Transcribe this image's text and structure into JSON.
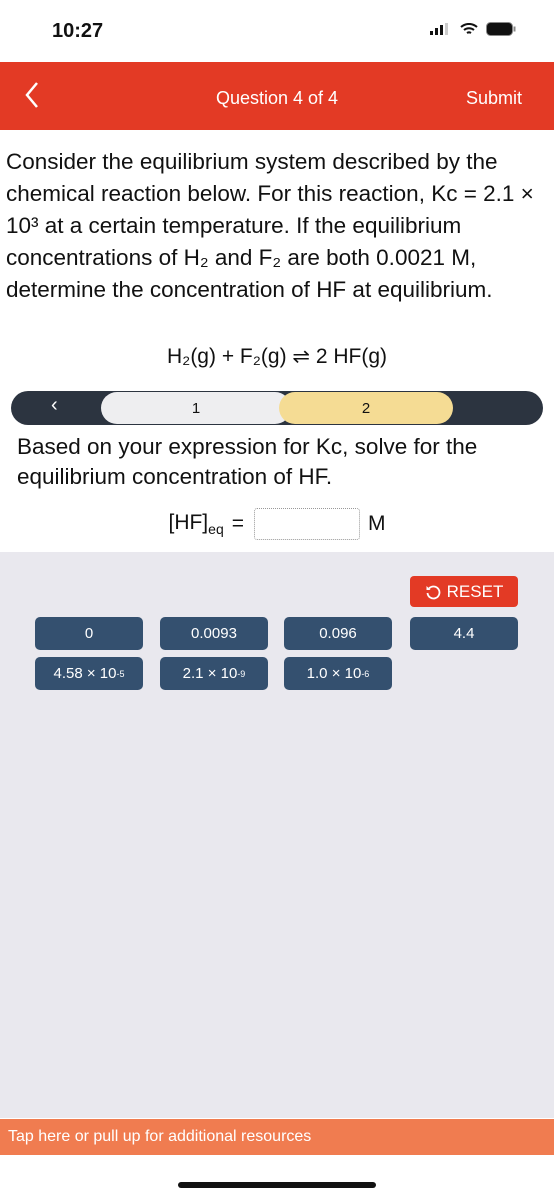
{
  "status": {
    "time": "10:27"
  },
  "header": {
    "back_icon": "chevron-left",
    "title": "Question 4 of 4",
    "submit": "Submit",
    "color": "#e33a25"
  },
  "question": "Consider the equilibrium system described by the chemical reaction below. For this reaction, Kc = 2.1 × 10³ at a certain temperature. If the equilibrium concentrations of H₂ and F₂ are both 0.0021 M, determine the concentration of HF at equilibrium.",
  "reaction": "H₂(g) + F₂(g) ⇌ 2 HF(g)",
  "steps": {
    "items": [
      "1",
      "2"
    ],
    "active": "2"
  },
  "instruction": "Based on your expression for Kc, solve for the equilibrium concentration of HF.",
  "equation": {
    "lhs": "[HF]",
    "sub": "eq",
    "equals": "=",
    "unit": "M",
    "value": ""
  },
  "tray": {
    "reset": "RESET",
    "row1": [
      "0",
      "0.0093",
      "0.096",
      "4.4"
    ],
    "row2": [
      {
        "base": "4.58 × 10",
        "exp": "-5"
      },
      {
        "base": "2.1 × 10",
        "exp": "-9"
      },
      {
        "base": "1.0 × 10",
        "exp": "-6"
      }
    ]
  },
  "resources": "Tap here or pull up for additional resources"
}
